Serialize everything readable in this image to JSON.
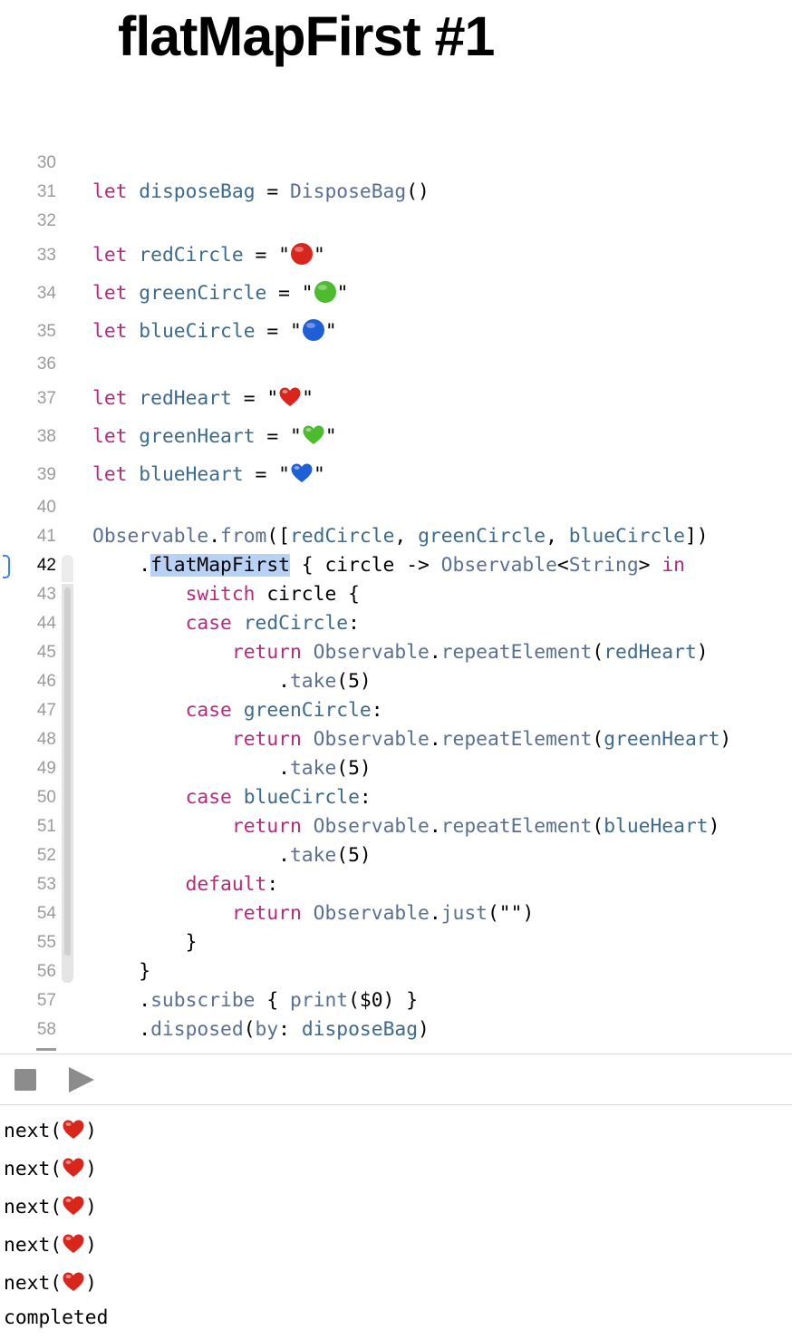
{
  "title": "flatMapFirst #1",
  "lines": [
    {
      "n": "30"
    },
    {
      "n": "31",
      "tokens": [
        [
          "kw",
          "let"
        ],
        [
          "",
          " "
        ],
        [
          "id",
          "disposeBag"
        ],
        [
          "",
          " = "
        ],
        [
          "ty",
          "DisposeBag"
        ],
        [
          "",
          "()"
        ]
      ]
    },
    {
      "n": "32"
    },
    {
      "n": "33",
      "tokens": [
        [
          "kw",
          "let"
        ],
        [
          "",
          " "
        ],
        [
          "id",
          "redCircle"
        ],
        [
          "",
          " = \""
        ],
        [
          "emoji",
          "red-circle"
        ],
        [
          "",
          "\""
        ]
      ]
    },
    {
      "n": "34",
      "tokens": [
        [
          "kw",
          "let"
        ],
        [
          "",
          " "
        ],
        [
          "id",
          "greenCircle"
        ],
        [
          "",
          " = \""
        ],
        [
          "emoji",
          "green-circle"
        ],
        [
          "",
          "\""
        ]
      ]
    },
    {
      "n": "35",
      "tokens": [
        [
          "kw",
          "let"
        ],
        [
          "",
          " "
        ],
        [
          "id",
          "blueCircle"
        ],
        [
          "",
          " = \""
        ],
        [
          "emoji",
          "blue-circle"
        ],
        [
          "",
          "\""
        ]
      ]
    },
    {
      "n": "36"
    },
    {
      "n": "37",
      "tokens": [
        [
          "kw",
          "let"
        ],
        [
          "",
          " "
        ],
        [
          "id",
          "redHeart"
        ],
        [
          "",
          " = \""
        ],
        [
          "emoji",
          "red-heart"
        ],
        [
          "",
          "\""
        ]
      ]
    },
    {
      "n": "38",
      "tokens": [
        [
          "kw",
          "let"
        ],
        [
          "",
          " "
        ],
        [
          "id",
          "greenHeart"
        ],
        [
          "",
          " = \""
        ],
        [
          "emoji",
          "green-heart"
        ],
        [
          "",
          "\""
        ]
      ]
    },
    {
      "n": "39",
      "tokens": [
        [
          "kw",
          "let"
        ],
        [
          "",
          " "
        ],
        [
          "id",
          "blueHeart"
        ],
        [
          "",
          " = \""
        ],
        [
          "emoji",
          "blue-heart"
        ],
        [
          "",
          "\""
        ]
      ]
    },
    {
      "n": "40"
    },
    {
      "n": "41",
      "tokens": [
        [
          "ty",
          "Observable"
        ],
        [
          "",
          "."
        ],
        [
          "fn",
          "from"
        ],
        [
          "",
          "(["
        ],
        [
          "id",
          "redCircle"
        ],
        [
          "",
          ", "
        ],
        [
          "id",
          "greenCircle"
        ],
        [
          "",
          ", "
        ],
        [
          "id",
          "blueCircle"
        ],
        [
          "",
          "])"
        ]
      ]
    },
    {
      "n": "42",
      "active": true,
      "tokens": [
        [
          "",
          "    ."
        ],
        [
          "hl",
          "flatMapFirst"
        ],
        [
          "",
          " { circle -> "
        ],
        [
          "ty",
          "Observable"
        ],
        [
          "",
          "<"
        ],
        [
          "ty",
          "String"
        ],
        [
          "",
          "> "
        ],
        [
          "kw",
          "in"
        ]
      ]
    },
    {
      "n": "43",
      "tokens": [
        [
          "",
          "        "
        ],
        [
          "kw",
          "switch"
        ],
        [
          "",
          " circle {"
        ]
      ]
    },
    {
      "n": "44",
      "tokens": [
        [
          "",
          "        "
        ],
        [
          "kw",
          "case"
        ],
        [
          "",
          " "
        ],
        [
          "id",
          "redCircle"
        ],
        [
          "",
          ":"
        ]
      ]
    },
    {
      "n": "45",
      "tokens": [
        [
          "",
          "            "
        ],
        [
          "kw",
          "return"
        ],
        [
          "",
          " "
        ],
        [
          "ty",
          "Observable"
        ],
        [
          "",
          "."
        ],
        [
          "fn",
          "repeatElement"
        ],
        [
          "",
          "("
        ],
        [
          "id",
          "redHeart"
        ],
        [
          "",
          ")"
        ]
      ]
    },
    {
      "n": "46",
      "tokens": [
        [
          "",
          "                ."
        ],
        [
          "fn",
          "take"
        ],
        [
          "",
          "(5)"
        ]
      ]
    },
    {
      "n": "47",
      "tokens": [
        [
          "",
          "        "
        ],
        [
          "kw",
          "case"
        ],
        [
          "",
          " "
        ],
        [
          "id",
          "greenCircle"
        ],
        [
          "",
          ":"
        ]
      ]
    },
    {
      "n": "48",
      "tokens": [
        [
          "",
          "            "
        ],
        [
          "kw",
          "return"
        ],
        [
          "",
          " "
        ],
        [
          "ty",
          "Observable"
        ],
        [
          "",
          "."
        ],
        [
          "fn",
          "repeatElement"
        ],
        [
          "",
          "("
        ],
        [
          "id",
          "greenHeart"
        ],
        [
          "",
          ")"
        ]
      ]
    },
    {
      "n": "49",
      "tokens": [
        [
          "",
          "                ."
        ],
        [
          "fn",
          "take"
        ],
        [
          "",
          "(5)"
        ]
      ]
    },
    {
      "n": "50",
      "tokens": [
        [
          "",
          "        "
        ],
        [
          "kw",
          "case"
        ],
        [
          "",
          " "
        ],
        [
          "id",
          "blueCircle"
        ],
        [
          "",
          ":"
        ]
      ]
    },
    {
      "n": "51",
      "tokens": [
        [
          "",
          "            "
        ],
        [
          "kw",
          "return"
        ],
        [
          "",
          " "
        ],
        [
          "ty",
          "Observable"
        ],
        [
          "",
          "."
        ],
        [
          "fn",
          "repeatElement"
        ],
        [
          "",
          "("
        ],
        [
          "id",
          "blueHeart"
        ],
        [
          "",
          ")"
        ]
      ]
    },
    {
      "n": "52",
      "tokens": [
        [
          "",
          "                ."
        ],
        [
          "fn",
          "take"
        ],
        [
          "",
          "(5)"
        ]
      ]
    },
    {
      "n": "53",
      "tokens": [
        [
          "",
          "        "
        ],
        [
          "kw",
          "default"
        ],
        [
          "",
          ":"
        ]
      ]
    },
    {
      "n": "54",
      "tokens": [
        [
          "",
          "            "
        ],
        [
          "kw",
          "return"
        ],
        [
          "",
          " "
        ],
        [
          "ty",
          "Observable"
        ],
        [
          "",
          "."
        ],
        [
          "fn",
          "just"
        ],
        [
          "",
          "(\"\")"
        ]
      ]
    },
    {
      "n": "55",
      "tokens": [
        [
          "",
          "        }"
        ]
      ]
    },
    {
      "n": "56",
      "tokens": [
        [
          "",
          "    }"
        ]
      ]
    },
    {
      "n": "57",
      "tokens": [
        [
          "",
          "    ."
        ],
        [
          "fn",
          "subscribe"
        ],
        [
          "",
          " { "
        ],
        [
          "fn",
          "print"
        ],
        [
          "",
          "($0) }"
        ]
      ]
    },
    {
      "n": "58",
      "tokens": [
        [
          "",
          "    ."
        ],
        [
          "fn",
          "disposed"
        ],
        [
          "",
          "("
        ],
        [
          "fn",
          "by"
        ],
        [
          "",
          ": "
        ],
        [
          "id",
          "disposeBag"
        ],
        [
          "",
          ")"
        ]
      ]
    }
  ],
  "console": {
    "lines": [
      [
        [
          "",
          "next("
        ],
        [
          "emoji",
          "red-heart"
        ],
        [
          "",
          ")"
        ]
      ],
      [
        [
          "",
          "next("
        ],
        [
          "emoji",
          "red-heart"
        ],
        [
          "",
          ")"
        ]
      ],
      [
        [
          "",
          "next("
        ],
        [
          "emoji",
          "red-heart"
        ],
        [
          "",
          ")"
        ]
      ],
      [
        [
          "",
          "next("
        ],
        [
          "emoji",
          "red-heart"
        ],
        [
          "",
          ")"
        ]
      ],
      [
        [
          "",
          "next("
        ],
        [
          "emoji",
          "red-heart"
        ],
        [
          "",
          ")"
        ]
      ],
      [
        [
          "",
          "completed"
        ]
      ]
    ]
  },
  "colors": {
    "keyword": "#b8287d",
    "identifier": "#3a6a8f",
    "type": "#5a6f95",
    "highlight": "#b7d2f4",
    "red": "#d9261c",
    "green": "#4cbb2f",
    "blue": "#1f5fd6"
  }
}
